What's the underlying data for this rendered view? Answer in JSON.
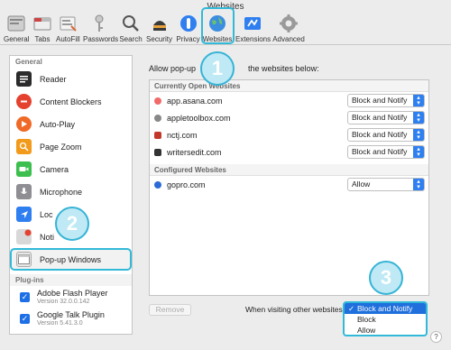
{
  "window": {
    "title": "Websites"
  },
  "toolbar": [
    {
      "label": "General",
      "icon": "general-icon"
    },
    {
      "label": "Tabs",
      "icon": "tabs-icon"
    },
    {
      "label": "AutoFill",
      "icon": "autofill-icon"
    },
    {
      "label": "Passwords",
      "icon": "passwords-icon"
    },
    {
      "label": "Search",
      "icon": "search-icon"
    },
    {
      "label": "Security",
      "icon": "security-icon"
    },
    {
      "label": "Privacy",
      "icon": "privacy-icon"
    },
    {
      "label": "Websites",
      "icon": "websites-icon"
    },
    {
      "label": "Extensions",
      "icon": "extensions-icon"
    },
    {
      "label": "Advanced",
      "icon": "advanced-icon"
    }
  ],
  "sidebar": {
    "general_header": "General",
    "items": [
      {
        "label": "Reader",
        "icon": "reader-icon",
        "color": "#222222"
      },
      {
        "label": "Content Blockers",
        "icon": "content-blockers-icon",
        "color": "#e5412f"
      },
      {
        "label": "Auto-Play",
        "icon": "auto-play-icon",
        "color": "#f06a27"
      },
      {
        "label": "Page Zoom",
        "icon": "page-zoom-icon",
        "color": "#f29a1b"
      },
      {
        "label": "Camera",
        "icon": "camera-icon",
        "color": "#3cbf4f"
      },
      {
        "label": "Microphone",
        "icon": "microphone-icon",
        "color": "#8e8e93"
      },
      {
        "label": "Loc",
        "icon": "location-icon",
        "color": "#2f7ff0"
      },
      {
        "label": "Noti",
        "icon": "notifications-icon",
        "color": "#d8d8d8"
      },
      {
        "label": "Pop-up Windows",
        "icon": "popup-windows-icon",
        "color": "#e8e8e8"
      }
    ],
    "plugins_header": "Plug-ins",
    "plugins": [
      {
        "name": "Adobe Flash Player",
        "version": "Version 32.0.0.142",
        "checked": true
      },
      {
        "name": "Google Talk Plugin",
        "version": "Version 5.41.3.0",
        "checked": true
      }
    ]
  },
  "main": {
    "intro_label": "Allow pop-up windows on the websites below:",
    "intro_visible_left": "Allow pop-up",
    "intro_visible_right": "the websites below:",
    "currently_open_header": "Currently Open Websites",
    "currently_open": [
      {
        "site": "app.asana.com",
        "value": "Block and Notify",
        "favicon_color": "#f06a6a"
      },
      {
        "site": "appletoolbox.com",
        "value": "Block and Notify",
        "favicon_color": "#888888"
      },
      {
        "site": "nctj.com",
        "value": "Block and Notify",
        "favicon_color": "#c0392b"
      },
      {
        "site": "writersedit.com",
        "value": "Block and Notify",
        "favicon_color": "#333333"
      }
    ],
    "configured_header": "Configured Websites",
    "configured": [
      {
        "site": "gopro.com",
        "value": "Allow",
        "favicon_color": "#2c6bd6"
      }
    ],
    "remove_button": "Remove",
    "other_websites_label": "When visiting other websites:",
    "dropdown_options": [
      "Block and Notify",
      "Block",
      "Allow"
    ],
    "dropdown_selected": "Block and Notify"
  },
  "help": "?",
  "callouts": [
    "1",
    "2",
    "3"
  ],
  "accent_color": "#32b9d8"
}
